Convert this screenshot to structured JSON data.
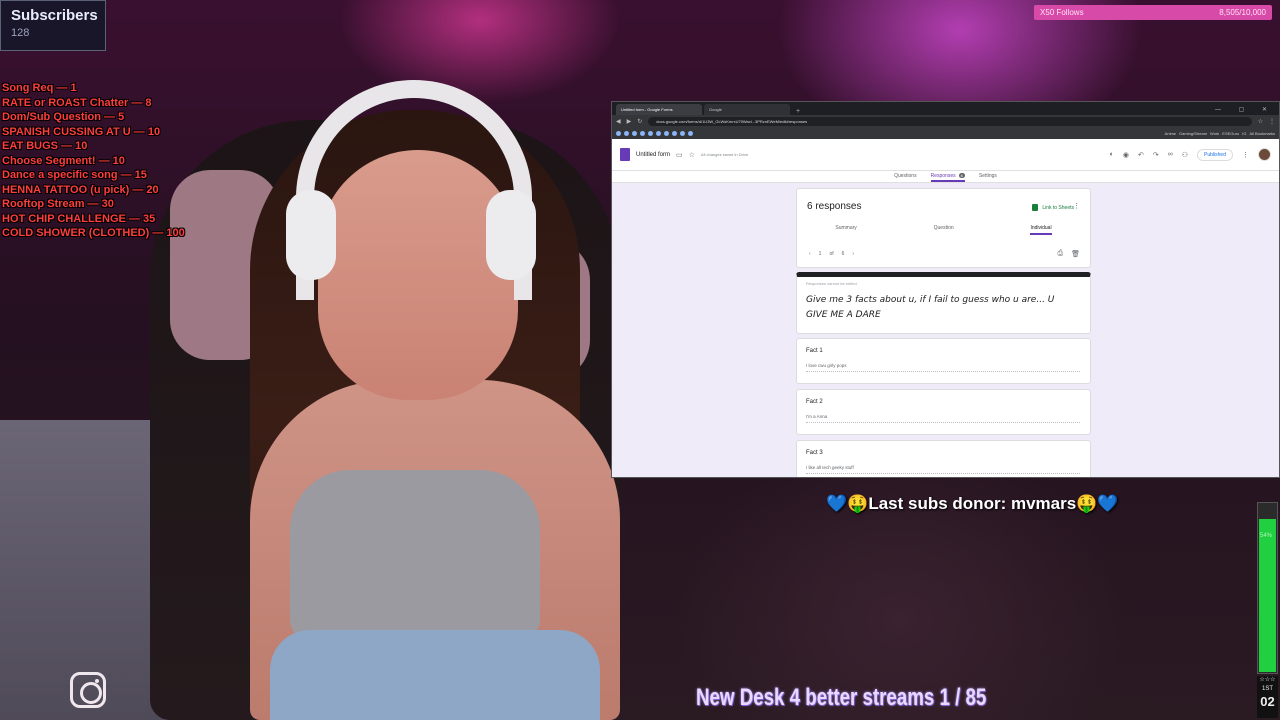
{
  "subscribers": {
    "title": "Subscribers",
    "count": "128"
  },
  "menu": [
    "Song Req — 1",
    "RATE or ROAST Chatter — 8",
    "Dom/Sub Question — 5",
    "SPANISH CUSSING AT U — 10",
    "EAT BUGS — 10",
    "Choose Segment! — 10",
    "Dance a specific song — 15",
    "HENNA TATTOO (u pick) — 20",
    "Rooftop Stream — 30",
    "HOT CHIP CHALLENGE — 35",
    "COLD SHOWER (CLOTHED) — 100"
  ],
  "follow_goal": {
    "label": "X50 Follows",
    "value": "8,505/10,000"
  },
  "donor": {
    "text": "💙🤑Last subs donor: mvmars🤑💙"
  },
  "desk_goal": {
    "text": "New Desk 4 better streams  1 / 85"
  },
  "meter": {
    "label": "54%",
    "level": 0.9
  },
  "clock": {
    "top": "☆☆☆",
    "mid": "1ST",
    "num": "02"
  },
  "browser": {
    "tabs": [
      "Untitled form - Google Forms",
      "Google"
    ],
    "new_tab": "+",
    "window_controls": "—  ▢  ✕",
    "url": "docs.google.com/forms/d/1U3W_GLWsKmrxU79Waxl...3PRznEWeM/edit#responses",
    "bookmarks": [
      "Anime",
      "Gaming/Stream",
      "Work",
      "ESEGuru",
      "IG",
      "All Bookmarks"
    ]
  },
  "form": {
    "title": "Untitled form",
    "saved_note": "All changes saved in Drive",
    "publish_label": "Published",
    "tabs": [
      "Questions",
      "Responses",
      "Settings"
    ],
    "responses_badge": "6",
    "responses_title": "6 responses",
    "link_sheets": "Link to Sheets",
    "sub_tabs": [
      "Summary",
      "Question",
      "Individual"
    ],
    "pager": {
      "current": "1",
      "of": "of",
      "total": "6"
    },
    "locked_note": "Responses cannot be edited",
    "question": "Give me 3 facts about u, if I fail to guess who u are... U GIVE ME A DARE",
    "facts": [
      {
        "title": "Fact 1",
        "answer": "I love cwu girly pops"
      },
      {
        "title": "Fact 2",
        "answer": "I'm a Anna"
      },
      {
        "title": "Fact 3",
        "answer": "I like all tech geeky stuff"
      }
    ]
  }
}
